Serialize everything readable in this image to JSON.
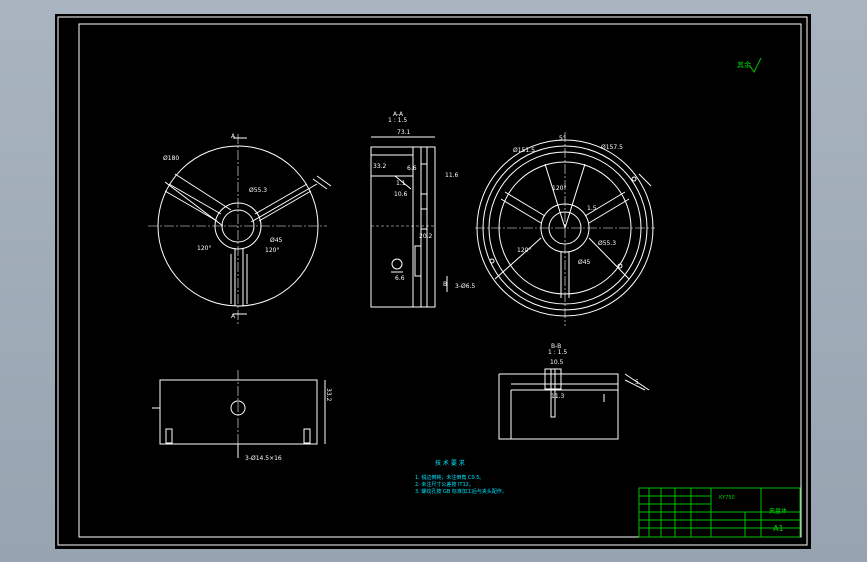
{
  "viewport_bg": "#000000",
  "window_bg": "#a9b4c0",
  "colors": {
    "geometry": "#ffffff",
    "title_block": "#00c000",
    "notes": "#00e5ff"
  },
  "front_view": {
    "dia_outer": "Ø180",
    "dia_bore": "Ø55.3",
    "dia_hub": "Ø45",
    "angle_left": "120°",
    "angle_right": "120°",
    "section_mark_top": "A",
    "section_mark_bottom": "A"
  },
  "section_view": {
    "title": "A-A",
    "scale": "1 : 1.5",
    "width_dim": "73.1",
    "dim_a": "33.2",
    "dim_b": "6.6",
    "dim_c": "11.6",
    "dim_d": "1.1",
    "dim_e": "10.6",
    "dim_f": "20.2",
    "dim_g": "6.6",
    "mark_b": "B"
  },
  "right_view": {
    "dia_inner_ring": "Ø151.5",
    "dia_outer_ring": "Ø157.5",
    "angle_top": "5°",
    "angle_left": "120°",
    "angle_mid": "120°",
    "dia_bore": "Ø55.3",
    "dia_hub": "Ø45",
    "slot_dim": "1.5",
    "holes": "3-Ø6.5"
  },
  "bottom_view": {
    "height_dim": "33.2",
    "holes": "3-Ø14.5×16"
  },
  "detail_view": {
    "title": "B-B",
    "scale": "1 : 1.5",
    "dim_top": "10.5",
    "dim_bottom": "11.3",
    "dim_right": "5"
  },
  "roughness_mark": "其余",
  "notes": {
    "title": "技 术 要 求",
    "items": [
      "1. 锐边倒钝，未注倒角 C0.5。",
      "2. 未注尺寸公差按 IT12。",
      "3. 螺纹孔按 GB 标准加工后与夹头配作。"
    ]
  },
  "title_block": {
    "drawing_code": "KY750",
    "part_name": "夹盘体",
    "sheet_size": "A1"
  }
}
